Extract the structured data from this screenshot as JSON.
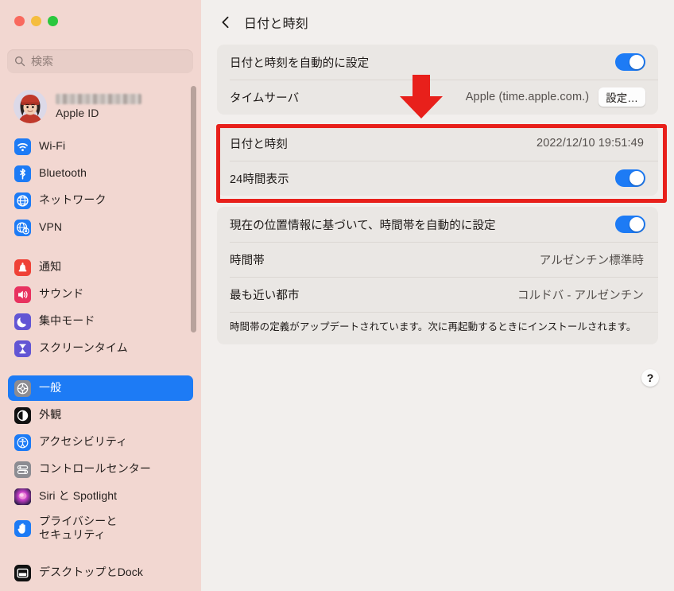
{
  "window": {
    "traffic_lights": [
      {
        "name": "close",
        "color": "#f9695e"
      },
      {
        "name": "minimize",
        "color": "#f5bd3f"
      },
      {
        "name": "maximize",
        "color": "#2bc73e"
      }
    ]
  },
  "sidebar": {
    "search": {
      "placeholder": "検索",
      "value": "",
      "icon": "search-icon"
    },
    "profile": {
      "name_redacted": true,
      "subtitle": "Apple ID",
      "avatar_icon": "memoji-avatar"
    },
    "groups": [
      {
        "items": [
          {
            "label": "Wi-Fi",
            "icon": "wifi-icon",
            "color": "#1d7bf5",
            "selected": false
          },
          {
            "label": "Bluetooth",
            "icon": "bluetooth-icon",
            "color": "#1d7bf5",
            "selected": false
          },
          {
            "label": "ネットワーク",
            "icon": "network-globe-icon",
            "color": "#1d7bf5",
            "selected": false
          },
          {
            "label": "VPN",
            "icon": "vpn-globe-icon",
            "color": "#1d7bf5",
            "selected": false
          }
        ]
      },
      {
        "items": [
          {
            "label": "通知",
            "icon": "bell-icon",
            "color": "#ef4237",
            "selected": false
          },
          {
            "label": "サウンド",
            "icon": "speaker-icon",
            "color": "#e8325f",
            "selected": false
          },
          {
            "label": "集中モード",
            "icon": "moon-icon",
            "color": "#6255d4",
            "selected": false
          },
          {
            "label": "スクリーンタイム",
            "icon": "hourglass-icon",
            "color": "#6255d4",
            "selected": false
          }
        ]
      },
      {
        "items": [
          {
            "label": "一般",
            "icon": "gear-icon",
            "color": "#8c8c92",
            "selected": true
          },
          {
            "label": "外観",
            "icon": "appearance-icon",
            "color": "#111111",
            "selected": false
          },
          {
            "label": "アクセシビリティ",
            "icon": "accessibility-icon",
            "color": "#1d7bf5",
            "selected": false
          },
          {
            "label": "コントロールセンター",
            "icon": "control-center-icon",
            "color": "#8c8c92",
            "selected": false
          },
          {
            "label": "Siri と Spotlight",
            "icon": "siri-icon",
            "color": "#3c2a5e",
            "selected": false
          },
          {
            "label": "プライバシーと\nセキュリティ",
            "icon": "hand-privacy-icon",
            "color": "#1d7bf5",
            "selected": false
          }
        ]
      },
      {
        "items": [
          {
            "label": "デスクトップとDock",
            "icon": "desktop-dock-icon",
            "color": "#111111",
            "selected": false
          }
        ]
      }
    ]
  },
  "main": {
    "header": {
      "back_icon": "chevron-left-icon",
      "title": "日付と時刻"
    },
    "cards": [
      {
        "name": "auto-datetime-card",
        "rows": [
          {
            "name": "auto-set-datetime",
            "label": "日付と時刻を自動的に設定",
            "control": "toggle",
            "toggle_on": true
          },
          {
            "name": "time-server",
            "label": "タイムサーバ",
            "value": "Apple (time.apple.com.)",
            "control": "button",
            "button_label": "設定…"
          }
        ]
      },
      {
        "name": "datetime-card",
        "highlighted": true,
        "rows": [
          {
            "name": "date-and-time",
            "label": "日付と時刻",
            "value": "2022/12/10 19:51:49",
            "control": "none"
          },
          {
            "name": "twentyfour-hour",
            "label": "24時間表示",
            "control": "toggle",
            "toggle_on": true
          }
        ]
      },
      {
        "name": "timezone-card",
        "rows": [
          {
            "name": "auto-set-timezone",
            "label": "現在の位置情報に基づいて、時間帯を自動的に設定",
            "control": "toggle",
            "toggle_on": true
          },
          {
            "name": "timezone",
            "label": "時間帯",
            "value": "アルゼンチン標準時",
            "control": "none"
          },
          {
            "name": "closest-city",
            "label": "最も近い都市",
            "value": "コルドバ - アルゼンチン",
            "control": "none"
          }
        ],
        "note": "時間帯の定義がアップデートされています。次に再起動するときにインストールされます。"
      }
    ],
    "help_button_label": "?"
  },
  "annotations": {
    "highlight_color": "#e8201b",
    "arrow_color": "#e8201b",
    "arrow_direction": "down"
  }
}
